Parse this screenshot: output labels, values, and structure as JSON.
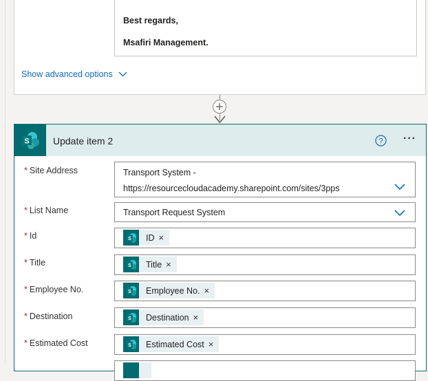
{
  "email": {
    "line1": "Best regards,",
    "line2": "Msafiri Management."
  },
  "advanced_options_label": "Show advanced options",
  "action": {
    "title": "Update item 2",
    "fields": [
      {
        "label": "Site Address",
        "value_line1": "Transport System -",
        "value_line2": "https://resourcecloudacademy.sharepoint.com/sites/3pps"
      },
      {
        "label": "List Name",
        "value": "Transport Request System"
      },
      {
        "label": "Id",
        "token": "ID"
      },
      {
        "label": "Title",
        "token": "Title"
      },
      {
        "label": "Employee No.",
        "token": "Employee No."
      },
      {
        "label": "Destination",
        "token": "Destination"
      },
      {
        "label": "Estimated Cost",
        "token": "Estimated Cost"
      }
    ]
  },
  "colors": {
    "sharepoint_teal": "#036c70",
    "card_border": "#0d6b6b",
    "header_bg": "#dfecec",
    "link_blue": "#0f6cbd",
    "required_red": "#a4262c",
    "token_bg": "#e8f0f1"
  },
  "icons": [
    "sharepoint-icon",
    "help-icon",
    "more-options-icon",
    "chevron-down-icon",
    "add-step-icon",
    "remove-token-icon"
  ]
}
